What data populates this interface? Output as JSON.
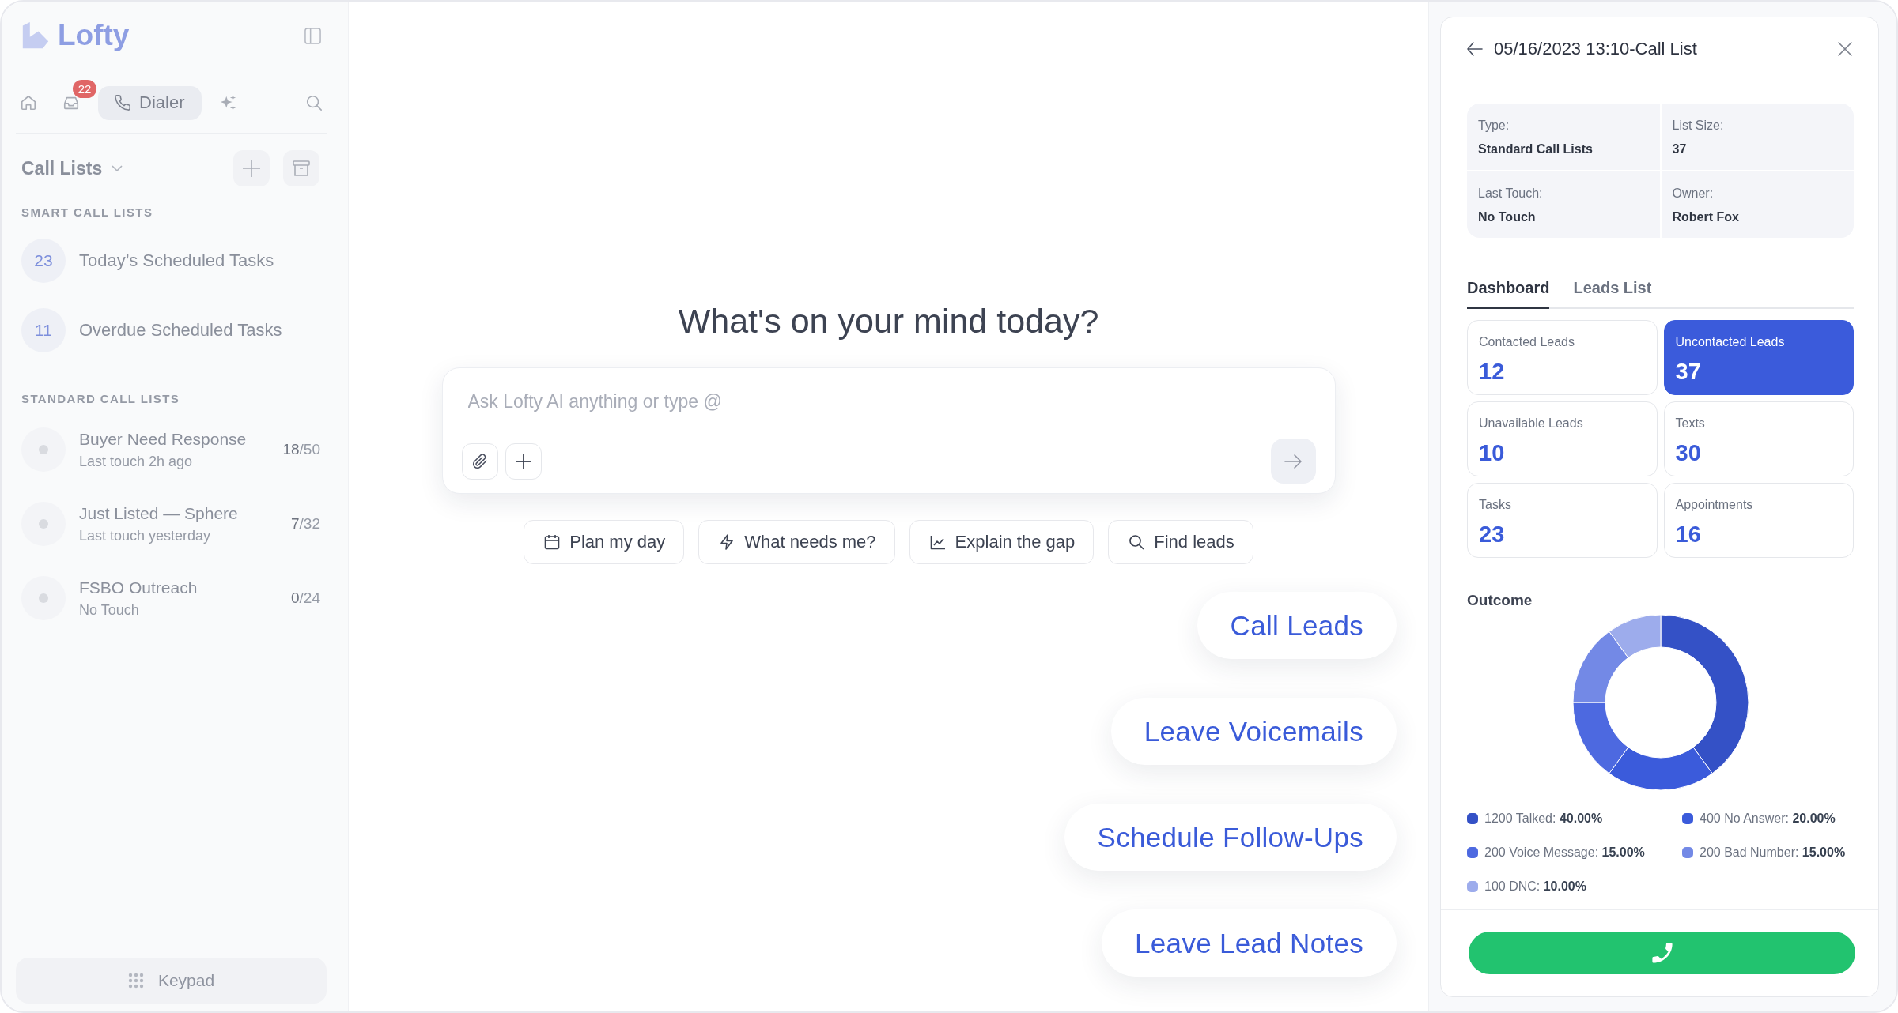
{
  "sidebar": {
    "logo": "Lofty",
    "nav": [
      {
        "selected": false
      },
      {
        "badge": "22",
        "selected": false
      },
      {
        "label": "Dialer",
        "selected": true
      },
      {
        "selected": false
      }
    ],
    "call_lists": {
      "title": "Call Lists",
      "sections": [
        {
          "heading": "SMART CALL LISTS",
          "items": [
            {
              "kind": "smart",
              "count": "23",
              "name": "Today’s Scheduled Tasks"
            },
            {
              "kind": "smart",
              "count": "11",
              "name": "Overdue Scheduled Tasks"
            }
          ]
        },
        {
          "heading": "STANDARD CALL LISTS",
          "items": [
            {
              "kind": "standard",
              "name": "Buyer Need Response",
              "subtitle": "Last touch 2h ago",
              "progress": "**18**/50"
            },
            {
              "kind": "standard",
              "name": "Just Listed — Sphere",
              "subtitle": "Last touch yesterday",
              "progress": "**7**/32"
            },
            {
              "kind": "standard",
              "name": "FSBO Outreach",
              "subtitle": "No Touch",
              "progress": "**0**/24"
            }
          ]
        }
      ]
    },
    "keypad": "Keypad"
  },
  "main": {
    "heading": "What's on your mind today?",
    "composer": {
      "placeholder": "Ask Lofty AI anything or type @"
    },
    "prompts": [
      "Plan my day",
      "What needs me?",
      "Explain the gap",
      "Find leads"
    ],
    "suggestions": [
      "Call Leads",
      "Leave Voicemails",
      "Schedule Follow-Ups",
      "Leave Lead Notes"
    ]
  },
  "panel": {
    "title": "05/16/2023 13:10-Call List",
    "details": [
      {
        "label": "Type:",
        "value": "Standard Call Lists"
      },
      {
        "label": "List Size:",
        "value": "37"
      },
      {
        "label": "Last Touch:",
        "value": "No Touch"
      },
      {
        "label": "Owner:",
        "value": "Robert Fox"
      }
    ],
    "tabs": [
      {
        "label": "Dashboard",
        "selected": true
      },
      {
        "label": "Leads List",
        "selected": false
      }
    ],
    "stats": [
      {
        "label": "Contacted Leads",
        "value": "12",
        "selected": false
      },
      {
        "label": "Uncontacted Leads",
        "value": "37",
        "selected": true
      },
      {
        "label": "Unavailable Leads",
        "value": "10",
        "selected": false
      },
      {
        "label": "Texts",
        "value": "30",
        "selected": false
      },
      {
        "label": "Tasks",
        "value": "23",
        "selected": false
      },
      {
        "label": "Appointments",
        "value": "16",
        "selected": false
      }
    ],
    "outcome": {
      "chart_data": {
        "type": "donut",
        "title": "Outcome",
        "values": [
          40,
          20,
          15,
          15,
          10
        ]
      },
      "legend": [
        {
          "text": "1200 Talked: **40.00%**",
          "color": "#3451c6"
        },
        {
          "text": "400 No Answer: **20.00%**",
          "color": "#3b5bdb"
        },
        {
          "text": "200 Voice Message: **15.00%**",
          "color": "#4d69e0"
        },
        {
          "text": "200 Bad Number: **15.00%**",
          "color": "#7389e6"
        },
        {
          "text": "100 DNC: **10.00%**",
          "color": "#9dacec"
        }
      ]
    }
  }
}
